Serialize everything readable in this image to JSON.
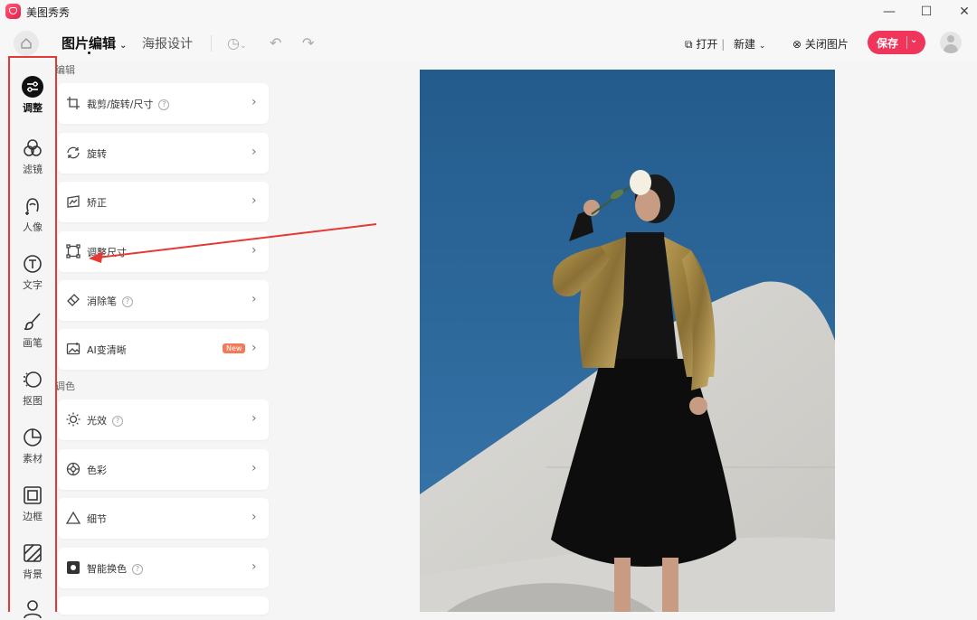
{
  "app": {
    "title": "美图秀秀"
  },
  "window": {
    "minimize": "—",
    "maximize": "☐",
    "close": "✕"
  },
  "toolbar": {
    "tab_active": "图片编辑",
    "tab_poster": "海报设计",
    "open_label": "打开",
    "new_label": "新建",
    "close_image_label": "关闭图片",
    "save_label": "保存"
  },
  "rail": [
    {
      "label": "调整",
      "icon": "adjust-icon",
      "active": true
    },
    {
      "label": "滤镜",
      "icon": "filter-icon"
    },
    {
      "label": "人像",
      "icon": "portrait-icon"
    },
    {
      "label": "文字",
      "icon": "text-icon"
    },
    {
      "label": "画笔",
      "icon": "brush-icon"
    },
    {
      "label": "抠图",
      "icon": "cutout-icon"
    },
    {
      "label": "素材",
      "icon": "sticker-icon"
    },
    {
      "label": "边框",
      "icon": "frame-icon"
    },
    {
      "label": "背景",
      "icon": "background-icon"
    }
  ],
  "panel": {
    "edit_section": "编辑",
    "edit_items": [
      {
        "label": "裁剪/旋转/尺寸",
        "help": true,
        "icon": "crop-icon"
      },
      {
        "label": "旋转",
        "icon": "rotate-icon"
      },
      {
        "label": "矫正",
        "icon": "correct-icon"
      },
      {
        "label": "调整尺寸",
        "icon": "resize-icon"
      },
      {
        "label": "消除笔",
        "help": true,
        "icon": "eraser-icon"
      },
      {
        "label": "AI变清晰",
        "badge": "New",
        "icon": "ai-sharpen-icon"
      }
    ],
    "color_section": "调色",
    "color_items": [
      {
        "label": "光效",
        "help": true,
        "icon": "light-icon"
      },
      {
        "label": "色彩",
        "icon": "color-icon"
      },
      {
        "label": "细节",
        "icon": "detail-icon"
      },
      {
        "label": "智能换色",
        "help": true,
        "icon": "smart-color-icon"
      }
    ]
  },
  "colors": {
    "accent": "#f0355a",
    "annotation": "#e53935",
    "sky": "#2c6596"
  }
}
